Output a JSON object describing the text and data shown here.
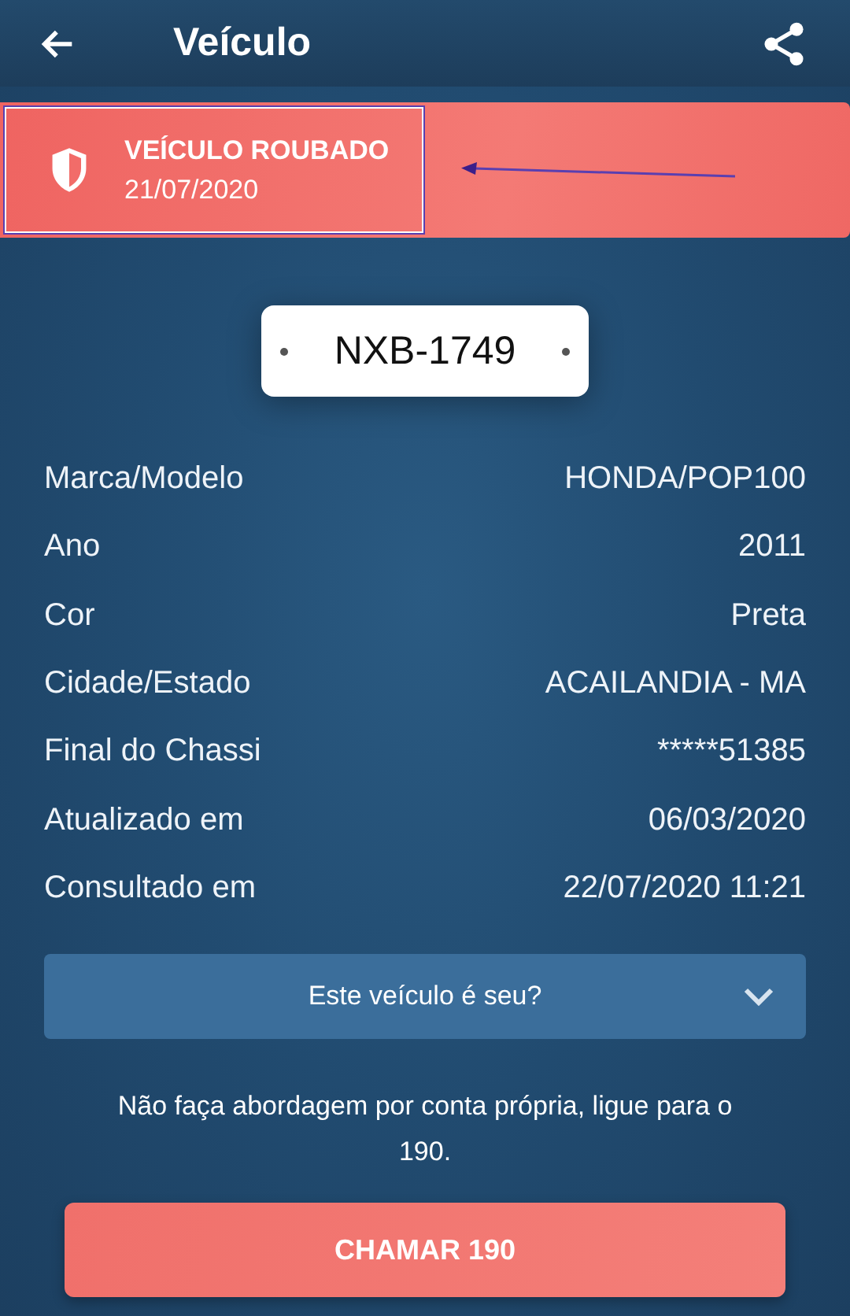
{
  "header": {
    "title": "Veículo"
  },
  "alert": {
    "title": "VEÍCULO ROUBADO",
    "date": "21/07/2020"
  },
  "plate": "NXB-1749",
  "details": [
    {
      "label": "Marca/Modelo",
      "value": "HONDA/POP100"
    },
    {
      "label": "Ano",
      "value": "2011"
    },
    {
      "label": "Cor",
      "value": "Preta"
    },
    {
      "label": "Cidade/Estado",
      "value": "ACAILANDIA - MA"
    },
    {
      "label": "Final do Chassi",
      "value": "*****51385"
    },
    {
      "label": "Atualizado em",
      "value": "06/03/2020"
    },
    {
      "label": "Consultado em",
      "value": "22/07/2020 11:21"
    }
  ],
  "owner_question": {
    "label": "Este veículo é seu?",
    "expanded": false
  },
  "warning": "Não faça abordagem por conta própria, ligue para o 190.",
  "call_button": "CHAMAR 190"
}
